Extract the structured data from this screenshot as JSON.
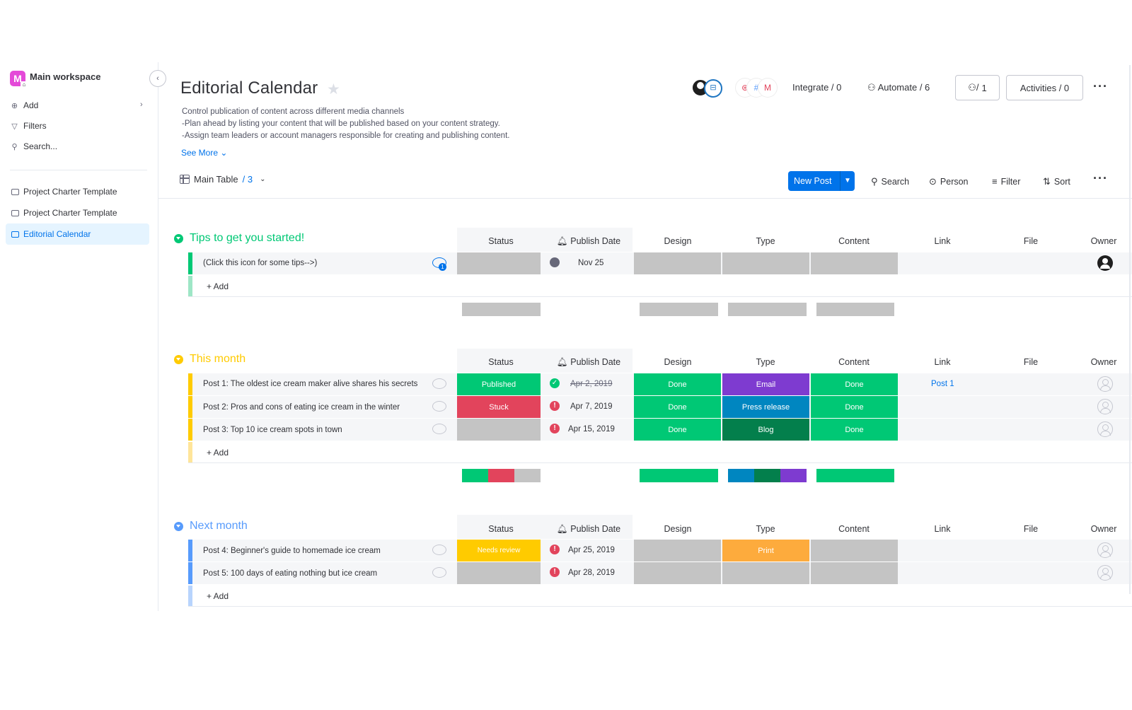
{
  "sidebar": {
    "workspace_initial": "M",
    "workspace_name": "Main workspace",
    "collapse_icon": "‹",
    "add_label": "Add",
    "filters_label": "Filters",
    "search_label": "Search...",
    "boards": [
      {
        "label": "Project Charter Template",
        "active": false
      },
      {
        "label": "Project Charter Template",
        "active": false
      },
      {
        "label": "Editorial Calendar",
        "active": true
      }
    ]
  },
  "header": {
    "title": "Editorial Calendar",
    "description_lines": [
      "Control publication of content across different media channels",
      "-Plan ahead by listing your content that will be published based on your content strategy.",
      "-Assign team leaders or account managers responsible for creating and publishing content."
    ],
    "see_more": "See More ⌄",
    "integrate": "Integrate / 0",
    "automate": "Automate / 6",
    "members": "1",
    "activities": "Activities / 0"
  },
  "toolbar": {
    "view_name": "Main Table",
    "view_count": "/ 3",
    "new_item": "New Post",
    "search": "Search",
    "person": "Person",
    "filter": "Filter",
    "sort": "Sort"
  },
  "columns": [
    "Status",
    "Publish Date",
    "Design",
    "Type",
    "Content",
    "Link",
    "File",
    "Owner"
  ],
  "colors": {
    "green": "#00c875",
    "red": "#e2445c",
    "purple": "#a25ddc",
    "blue": "#0086c0",
    "dark_green": "#037f4c",
    "yellow": "#fdab3d",
    "orange": "#ffcb00",
    "grey": "#c4c4c4",
    "brand_blue": "#0073ea"
  },
  "groups": [
    {
      "title": "Tips to get you started!",
      "color": "#00c875",
      "items": [
        {
          "name": "(Click this icon for some tips-->)",
          "date": "Nov 25",
          "link": ""
        }
      ]
    },
    {
      "title": "This month",
      "color": "#ffcb00",
      "items": [
        {
          "name": "Post 1: The oldest ice cream maker alive shares his secrets",
          "status": "Published",
          "date": "Apr 2, 2019",
          "design": "Done",
          "type": "Email",
          "content": "Done",
          "link": "Post 1"
        },
        {
          "name": "Post 2: Pros and cons of eating ice cream in the winter",
          "status": "Stuck",
          "date": "Apr 7, 2019",
          "design": "Done",
          "type": "Press release",
          "content": "Done",
          "link": ""
        },
        {
          "name": "Post 3: Top 10 ice cream spots in town",
          "status": "",
          "date": "Apr 15, 2019",
          "design": "Done",
          "type": "Blog",
          "content": "Done",
          "link": ""
        }
      ]
    },
    {
      "title": "Next month",
      "color": "#579bfc",
      "items": [
        {
          "name": "Post 4: Beginner's guide to homemade ice cream",
          "status": "Needs review",
          "date": "Apr 25, 2019",
          "type": "Print",
          "link": ""
        },
        {
          "name": "Post 5: 100 days of eating nothing but ice cream",
          "status": "",
          "date": "Apr 28, 2019",
          "type": "",
          "link": ""
        }
      ]
    }
  ],
  "add_item_label": "+ Add"
}
